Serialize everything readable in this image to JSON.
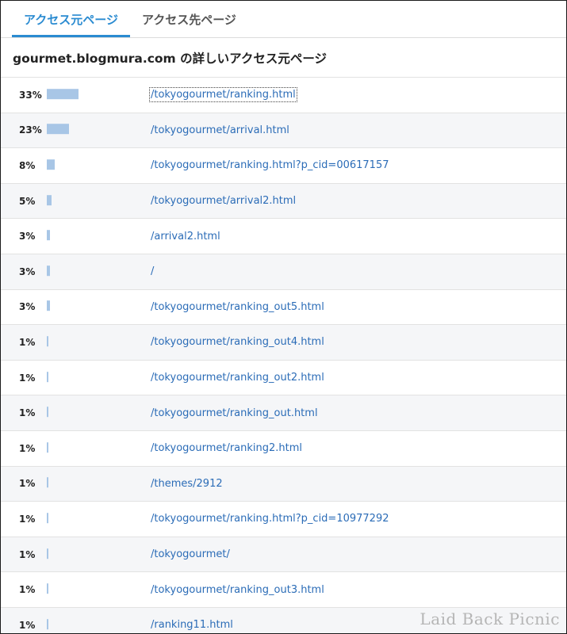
{
  "tabs": [
    {
      "label": "アクセス元ページ",
      "active": true
    },
    {
      "label": "アクセス先ページ",
      "active": false
    }
  ],
  "section_title": "gourmet.blogmura.com の詳しいアクセス元ページ",
  "rows": [
    {
      "percent": "33%",
      "share": 33,
      "path": "/tokyogourmet/ranking.html"
    },
    {
      "percent": "23%",
      "share": 23,
      "path": "/tokyogourmet/arrival.html"
    },
    {
      "percent": "8%",
      "share": 8,
      "path": "/tokyogourmet/ranking.html?p_cid=00617157"
    },
    {
      "percent": "5%",
      "share": 5,
      "path": "/tokyogourmet/arrival2.html"
    },
    {
      "percent": "3%",
      "share": 3,
      "path": "/arrival2.html"
    },
    {
      "percent": "3%",
      "share": 3,
      "path": "/"
    },
    {
      "percent": "3%",
      "share": 3,
      "path": "/tokyogourmet/ranking_out5.html"
    },
    {
      "percent": "1%",
      "share": 1,
      "path": "/tokyogourmet/ranking_out4.html"
    },
    {
      "percent": "1%",
      "share": 1,
      "path": "/tokyogourmet/ranking_out2.html"
    },
    {
      "percent": "1%",
      "share": 1,
      "path": "/tokyogourmet/ranking_out.html"
    },
    {
      "percent": "1%",
      "share": 1,
      "path": "/tokyogourmet/ranking2.html"
    },
    {
      "percent": "1%",
      "share": 1,
      "path": "/themes/2912"
    },
    {
      "percent": "1%",
      "share": 1,
      "path": "/tokyogourmet/ranking.html?p_cid=10977292"
    },
    {
      "percent": "1%",
      "share": 1,
      "path": "/tokyogourmet/"
    },
    {
      "percent": "1%",
      "share": 1,
      "path": "/tokyogourmet/ranking_out3.html"
    },
    {
      "percent": "1%",
      "share": 1,
      "path": "/ranking11.html"
    }
  ],
  "colors": {
    "accent": "#2a8bd1",
    "bar": "#a8c6e6",
    "link": "#2b6cb7"
  },
  "watermark": "Laid Back Picnic"
}
